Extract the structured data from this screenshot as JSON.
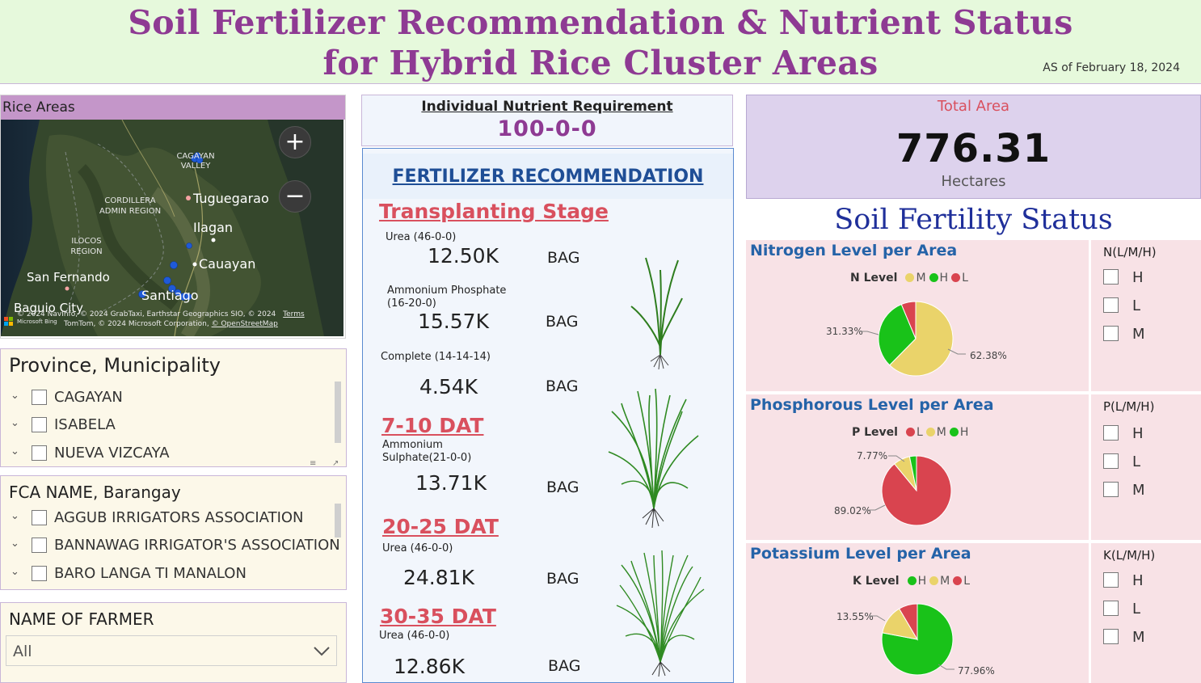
{
  "header": {
    "title_line1": "Soil Fertilizer Recommendation & Nutrient Status",
    "title_line2": "for Hybrid Rice Cluster Areas",
    "as_of": "AS of February 18, 2024"
  },
  "map": {
    "title": "Rice Areas",
    "zoom_in": "+",
    "zoom_out": "−",
    "labels": {
      "cagayan_valley": "CAGAYAN VALLEY",
      "cordillera": "CORDILLERA ADMIN REGION",
      "ilocos": "ILOCOS REGION",
      "tuguegarao": "Tuguegarao",
      "ilagan": "Ilagan",
      "cauayan": "Cauayan",
      "san_fernando": "San Fernando",
      "santiago": "Santiago",
      "baguio": "Baguio City"
    },
    "attribution_line1": "© 2024 NavInfo, © 2024 GrabTaxi, Earthstar Geographics SIO, © 2024",
    "attribution_terms": "Terms",
    "attribution_line2": "TomTom, © 2024 Microsoft Corporation,",
    "attribution_osm": "© OpenStreetMap",
    "bing_label": "Microsoft Bing"
  },
  "province_slicer": {
    "title": "Province, Municipality",
    "items": [
      "CAGAYAN",
      "ISABELA",
      "NUEVA VIZCAYA"
    ]
  },
  "fca_slicer": {
    "title": "FCA NAME, Barangay",
    "items": [
      "AGGUB IRRIGATORS ASSOCIATION",
      "BANNAWAG IRRIGATOR'S ASSOCIATION",
      "BARO LANGA TI MANALON"
    ]
  },
  "farmer_slicer": {
    "title": "NAME OF FARMER",
    "value": "All"
  },
  "requirement": {
    "title": "Individual Nutrient Requirement",
    "value": "100-0-0"
  },
  "fertilizer": {
    "title": "FERTILIZER RECOMMENDATION",
    "unit": "BAG",
    "stages": [
      {
        "name": "Transplanting Stage",
        "items": [
          {
            "fertilizer": "Urea (46-0-0)",
            "value": "12.50K"
          },
          {
            "fertilizer": "Ammonium Phosphate (16-20-0)",
            "value": "15.57K"
          },
          {
            "fertilizer": "Complete (14-14-14)",
            "value": "4.54K"
          }
        ]
      },
      {
        "name": "7-10 DAT",
        "items": [
          {
            "fertilizer": "Ammonium Sulphate(21-0-0)",
            "value": "13.71K"
          }
        ]
      },
      {
        "name": "20-25 DAT",
        "items": [
          {
            "fertilizer": "Urea (46-0-0)",
            "value": "24.81K"
          }
        ]
      },
      {
        "name": "30-35 DAT",
        "items": [
          {
            "fertilizer": "Urea (46-0-0)",
            "value": "12.86K"
          }
        ]
      }
    ]
  },
  "total_area": {
    "title": "Total Area",
    "value": "776.31",
    "unit": "Hectares"
  },
  "soil_fertility": {
    "title": "Soil Fertility Status",
    "colors": {
      "H": "#19c219",
      "M": "#ead36a",
      "L": "#d9444f"
    },
    "nutrients": [
      {
        "title": "Nitrogen Level per Area",
        "legend_title": "N Level",
        "legend": [
          "M",
          "H",
          "L"
        ],
        "slices": [
          {
            "level": "M",
            "percent": 62.38
          },
          {
            "level": "H",
            "percent": 31.33
          },
          {
            "level": "L",
            "percent": 6.29
          }
        ],
        "labels": [
          "31.33%",
          "62.38%"
        ]
      },
      {
        "title": "Phosphorous Level per Area",
        "legend_title": "P Level",
        "legend": [
          "L",
          "M",
          "H"
        ],
        "slices": [
          {
            "level": "L",
            "percent": 89.02
          },
          {
            "level": "M",
            "percent": 7.77
          },
          {
            "level": "H",
            "percent": 3.21
          }
        ],
        "labels": [
          "7.77%",
          "89.02%"
        ]
      },
      {
        "title": "Potassium Level per Area",
        "legend_title": "K Level",
        "legend": [
          "H",
          "M",
          "L"
        ],
        "slices": [
          {
            "level": "H",
            "percent": 77.96
          },
          {
            "level": "M",
            "percent": 13.55
          },
          {
            "level": "L",
            "percent": 8.49
          }
        ],
        "labels": [
          "13.55%",
          "77.96%"
        ]
      }
    ]
  },
  "level_slicers": [
    {
      "title": "N(L/M/H)",
      "options": [
        "H",
        "L",
        "M"
      ]
    },
    {
      "title": "P(L/M/H)",
      "options": [
        "H",
        "L",
        "M"
      ]
    },
    {
      "title": "K(L/M/H)",
      "options": [
        "H",
        "L",
        "M"
      ]
    }
  ]
}
